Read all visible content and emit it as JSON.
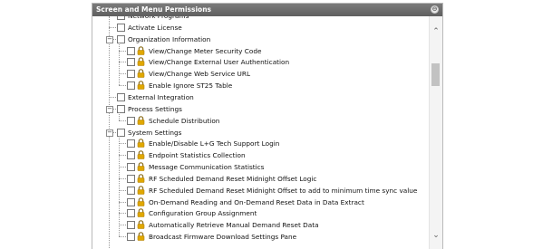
{
  "panel": {
    "title": "Screen and Menu Permissions",
    "collapse_glyph": "⊖"
  },
  "tree": {
    "rows": [
      {
        "label": "Network Programs",
        "level": 1,
        "lock": false,
        "expander": ""
      },
      {
        "label": "Activate License",
        "level": 1,
        "lock": false,
        "expander": ""
      },
      {
        "label": "Organization Information",
        "level": 1,
        "lock": false,
        "expander": "−"
      },
      {
        "label": "View/Change Meter Security Code",
        "level": 2,
        "lock": true,
        "expander": ""
      },
      {
        "label": "View/Change External User Authentication",
        "level": 2,
        "lock": true,
        "expander": ""
      },
      {
        "label": "View/Change Web Service URL",
        "level": 2,
        "lock": true,
        "expander": ""
      },
      {
        "label": "Enable Ignore ST25 Table",
        "level": 2,
        "lock": true,
        "expander": ""
      },
      {
        "label": "External Integration",
        "level": 1,
        "lock": false,
        "expander": ""
      },
      {
        "label": "Process Settings",
        "level": 1,
        "lock": false,
        "expander": "−"
      },
      {
        "label": "Schedule Distribution",
        "level": 2,
        "lock": true,
        "expander": ""
      },
      {
        "label": "System Settings",
        "level": 1,
        "lock": false,
        "expander": "−"
      },
      {
        "label": "Enable/Disable L+G Tech Support Login",
        "level": 2,
        "lock": true,
        "expander": ""
      },
      {
        "label": "Endpoint Statistics Collection",
        "level": 2,
        "lock": true,
        "expander": ""
      },
      {
        "label": "Message Communication Statistics",
        "level": 2,
        "lock": true,
        "expander": ""
      },
      {
        "label": "RF Scheduled Demand Reset Midnight Offset Logic",
        "level": 2,
        "lock": true,
        "expander": ""
      },
      {
        "label": "RF Scheduled Demand Reset Midnight Offset to add to minimum time sync value",
        "level": 2,
        "lock": true,
        "expander": ""
      },
      {
        "label": "On-Demand Reading and On-Demand Reset Data in Data Extract",
        "level": 2,
        "lock": true,
        "expander": ""
      },
      {
        "label": "Configuration Group Assignment",
        "level": 2,
        "lock": true,
        "expander": ""
      },
      {
        "label": "Automatically Retrieve Manual Demand Reset Data",
        "level": 2,
        "lock": true,
        "expander": ""
      },
      {
        "label": "Broadcast Firmware Download Settings Pane",
        "level": 2,
        "lock": true,
        "expander": ""
      }
    ]
  },
  "scrollbar": {
    "up_glyph": "⌃",
    "down_glyph": "⌄"
  },
  "colors": {
    "header": "#6b6b6b",
    "lock_body": "#e0a800",
    "lock_shackle": "#8a6d1b"
  }
}
